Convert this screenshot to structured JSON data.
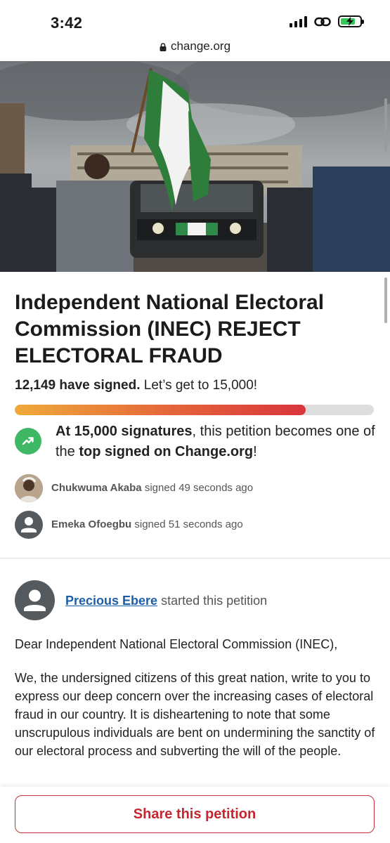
{
  "status_bar": {
    "time": "3:42",
    "icons": [
      "cellular-signal-icon",
      "link-icon",
      "battery-charging-icon"
    ]
  },
  "browser": {
    "url": "change.org",
    "lock_icon": "lock-icon"
  },
  "petition": {
    "title": "Independent National Electoral Commission (INEC) REJECT ELECTORAL FRAUD",
    "signed_count": "12,149 have signed.",
    "goal_text": "Let’s get to 15,000!",
    "progress_fraction": 0.81,
    "progress_colors": [
      "#efaa3a",
      "#d9343c"
    ],
    "milestone": {
      "strong1": "At 15,000 signatures",
      "mid": ", this petition becomes one of the ",
      "strong2": "top signed on Change.org",
      "end": "!"
    }
  },
  "recent_signers": [
    {
      "name": "Chukwuma Akaba",
      "action": "signed 49 seconds ago",
      "avatar": "photo"
    },
    {
      "name": "Emeka Ofoegbu",
      "action": "signed 51 seconds ago",
      "avatar": "person-icon"
    }
  ],
  "starter": {
    "name": "Precious Ebere",
    "action": "started this petition"
  },
  "letter": {
    "salutation": "Dear Independent National Electoral Commission (INEC),",
    "body": "We, the undersigned citizens of this great nation, write to you to express our deep concern over the increasing cases of electoral fraud in our country. It is disheartening to note that some unscrupulous individuals are bent on undermining the sanctity of our electoral process and subverting the will of the people."
  },
  "footer": {
    "share_label": "Share this petition"
  },
  "colors": {
    "accent_red": "#c5262f",
    "success_green": "#3fb865",
    "link_blue": "#1d5fa6"
  }
}
